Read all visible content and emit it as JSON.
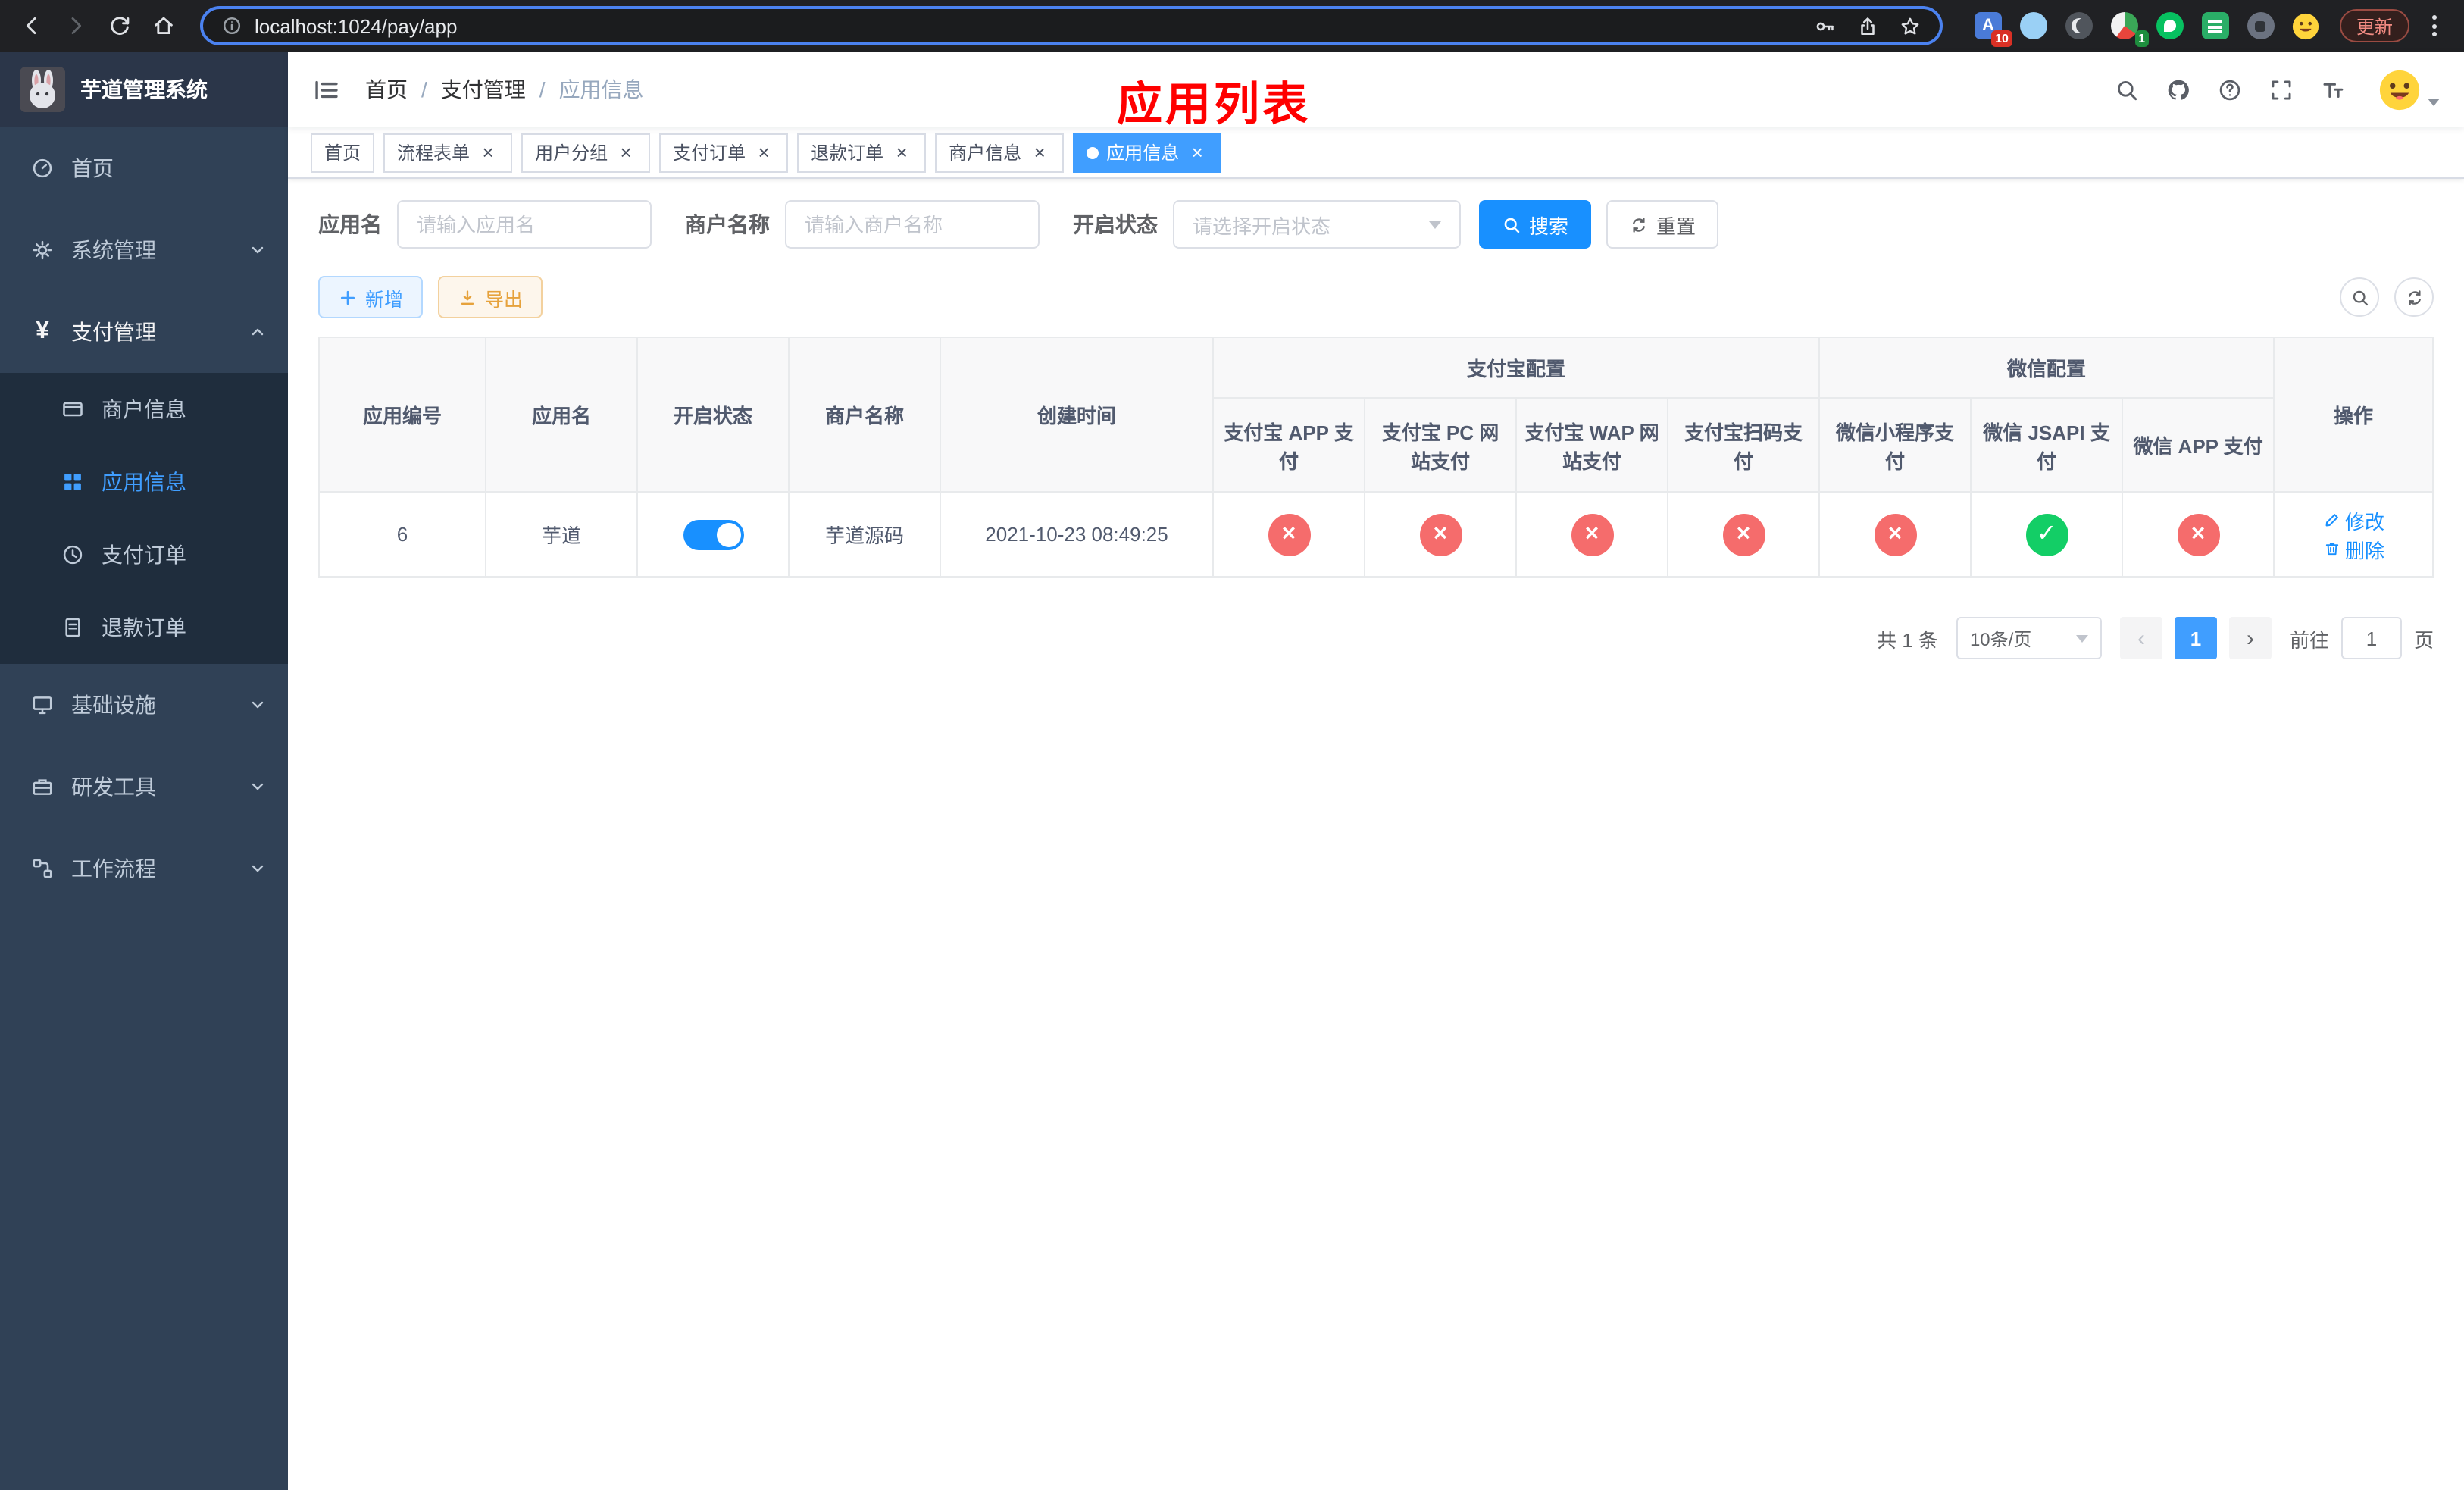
{
  "glyphs": {
    "ok": "✓",
    "fail": "×",
    "close": "×",
    "prev": "‹",
    "next": "›"
  },
  "browser": {
    "url": "localhost:1024/pay/app",
    "update_label": "更新",
    "ext_badges": {
      "first": "10",
      "second": "1"
    }
  },
  "sidebar": {
    "title": "芋道管理系统",
    "menu": [
      {
        "label": "首页"
      },
      {
        "label": "系统管理"
      },
      {
        "label": "支付管理"
      },
      {
        "label": "基础设施"
      },
      {
        "label": "研发工具"
      },
      {
        "label": "工作流程"
      }
    ],
    "submenu": [
      {
        "label": "商户信息"
      },
      {
        "label": "应用信息"
      },
      {
        "label": "支付订单"
      },
      {
        "label": "退款订单"
      }
    ]
  },
  "navbar": {
    "breadcrumb": [
      "首页",
      "支付管理",
      "应用信息"
    ],
    "separator": "/",
    "annotation": "应用列表"
  },
  "tabs": [
    {
      "label": "首页"
    },
    {
      "label": "流程表单"
    },
    {
      "label": "用户分组"
    },
    {
      "label": "支付订单"
    },
    {
      "label": "退款订单"
    },
    {
      "label": "商户信息"
    },
    {
      "label": "应用信息"
    }
  ],
  "filters": {
    "app_name": {
      "label": "应用名",
      "placeholder": "请输入应用名"
    },
    "merchant_name": {
      "label": "商户名称",
      "placeholder": "请输入商户名称"
    },
    "status": {
      "label": "开启状态",
      "placeholder": "请选择开启状态"
    },
    "search": "搜索",
    "reset": "重置"
  },
  "toolbar": {
    "add": "新增",
    "export": "导出"
  },
  "table": {
    "headers": {
      "app_id": "应用编号",
      "app_name": "应用名",
      "status": "开启状态",
      "merchant_name": "商户名称",
      "create_time": "创建时间",
      "alipay_group": "支付宝配置",
      "wechat_group": "微信配置",
      "alipay_app": "支付宝 APP 支付",
      "alipay_pc": "支付宝 PC 网站支付",
      "alipay_wap": "支付宝 WAP 网站支付",
      "alipay_qr": "支付宝扫码支付",
      "wechat_mini": "微信小程序支付",
      "wechat_jsapi": "微信 JSAPI 支付",
      "wechat_app": "微信 APP 支付",
      "actions": "操作"
    },
    "row": {
      "app_id": "6",
      "app_name": "芋道",
      "enabled": true,
      "merchant_name": "芋道源码",
      "create_time": "2021-10-23 08:49:25",
      "alipay_app": "disabled",
      "alipay_pc": "disabled",
      "alipay_wap": "disabled",
      "alipay_qr": "disabled",
      "wechat_mini": "disabled",
      "wechat_jsapi": "enabled",
      "wechat_app": "disabled",
      "edit": "修改",
      "delete": "删除"
    }
  },
  "pagination": {
    "total": "共 1 条",
    "page_size": "10条/页",
    "page": "1",
    "goto_label": "前往",
    "goto_value": "1",
    "goto_suffix": "页"
  },
  "colors": {
    "primary": "#409eff",
    "search_blue": "#1890ff",
    "success": "#13ce66",
    "danger": "#f56c6c",
    "warning": "#e6a23c"
  }
}
